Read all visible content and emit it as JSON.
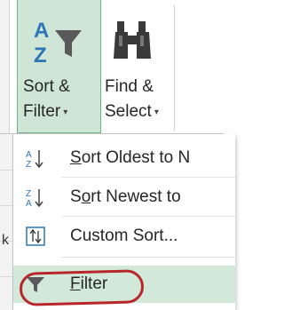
{
  "ribbon": {
    "sort_filter": {
      "line1": "Sort &",
      "line2": "Filter",
      "dropdown_arrow": "▾",
      "icon": "sort-az-funnel-icon"
    },
    "find_select": {
      "line1": "Find &",
      "line2": "Select",
      "dropdown_arrow": "▾",
      "icon": "binoculars-icon"
    }
  },
  "grid": {
    "visible_char": "k"
  },
  "menu": {
    "items": [
      {
        "label": "Sort Oldest to N",
        "icon": "sort-ascending-icon",
        "mnemonic": "S"
      },
      {
        "label": "Sort Newest to",
        "icon": "sort-descending-icon",
        "mnemonic": "o"
      },
      {
        "label": "Custom Sort...",
        "icon": "custom-sort-icon",
        "mnemonic": "U"
      },
      {
        "label": "Filter",
        "icon": "funnel-icon",
        "mnemonic": "F",
        "highlighted": true
      }
    ]
  },
  "colors": {
    "accent_green": "#cfe6d6",
    "accent_border": "#6fb38a",
    "menu_hover": "#d2e9d9",
    "annotation_red": "#b8262b",
    "sort_blue": "#2e75b6",
    "funnel_gray": "#595959"
  }
}
